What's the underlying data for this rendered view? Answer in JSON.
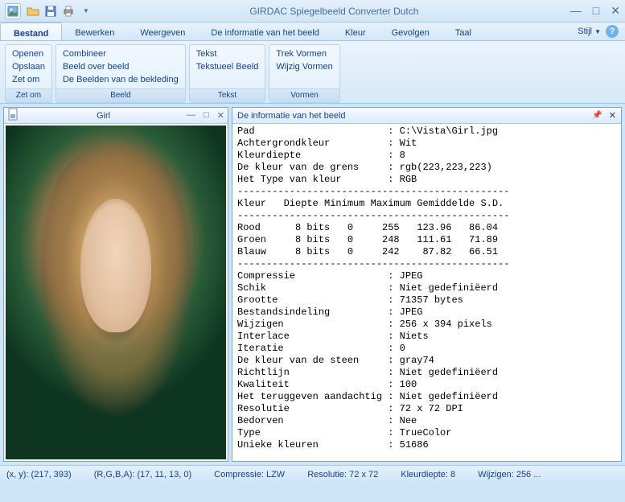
{
  "title": "GIRDAC Spiegelbeeld Converter Dutch",
  "menu": {
    "tabs": [
      "Bestand",
      "Bewerken",
      "Weergeven",
      "De informatie van het beeld",
      "Kleur",
      "Gevolgen",
      "Taal"
    ],
    "style": "Stijl"
  },
  "ribbon": {
    "g0": {
      "items": [
        "Openen",
        "Opslaan",
        "Zet om"
      ],
      "label": "Zet om"
    },
    "g1": {
      "items": [
        "Combineer",
        "Beeld over beeld",
        "De Beelden van de bekleding"
      ],
      "label": "Beeld"
    },
    "g2": {
      "items": [
        "Tekst",
        "Tekstueel Beeld"
      ],
      "label": "Tekst"
    },
    "g3": {
      "items": [
        "Trek Vormen",
        "Wijzig Vormen"
      ],
      "label": "Vormen"
    }
  },
  "doc": {
    "title": "Girl"
  },
  "info": {
    "title": "De informatie van het beeld",
    "rows": [
      [
        "Pad",
        "C:\\Vista\\Girl.jpg"
      ],
      [
        "Achtergrondkleur",
        "Wit"
      ],
      [
        "Kleurdiepte",
        "8"
      ],
      [
        "De kleur van de grens",
        "rgb(223,223,223)"
      ],
      [
        "Het Type van kleur",
        "RGB"
      ]
    ],
    "tableHeader": "Kleur   Diepte Minimum Maximum Gemiddelde S.D.",
    "table": [
      "Rood      8 bits   0     255   123.96   86.04",
      "Groen     8 bits   0     248   111.61   71.89",
      "Blauw     8 bits   0     242    87.82   66.51"
    ],
    "rows2": [
      [
        "Compressie",
        "JPEG"
      ],
      [
        "Schik",
        "Niet gedefiniëerd"
      ],
      [
        "Grootte",
        "71357 bytes"
      ],
      [
        "Bestandsindeling",
        "JPEG"
      ],
      [
        "Wijzigen",
        "256 x 394 pixels"
      ],
      [
        "Interlace",
        "Niets"
      ],
      [
        "Iteratie",
        "0"
      ],
      [
        "De kleur van de steen",
        "gray74"
      ],
      [
        "Richtlijn",
        "Niet gedefiniëerd"
      ],
      [
        "Kwaliteit",
        "100"
      ],
      [
        "Het teruggeven aandachtig",
        "Niet gedefiniëerd"
      ],
      [
        "Resolutie",
        "72 x 72 DPI"
      ],
      [
        "Bedorven",
        "Nee"
      ],
      [
        "Type",
        "TrueColor"
      ],
      [
        "Unieke kleuren",
        "51686"
      ]
    ]
  },
  "status": {
    "xy": "(x, y): (217, 393)",
    "rgba": "(R,G,B,A): (17, 11, 13, 0)",
    "comp": "Compressie: LZW",
    "res": "Resolutie: 72 x 72",
    "depth": "Kleurdiepte: 8",
    "mod": "Wijzigen: 256 ..."
  }
}
